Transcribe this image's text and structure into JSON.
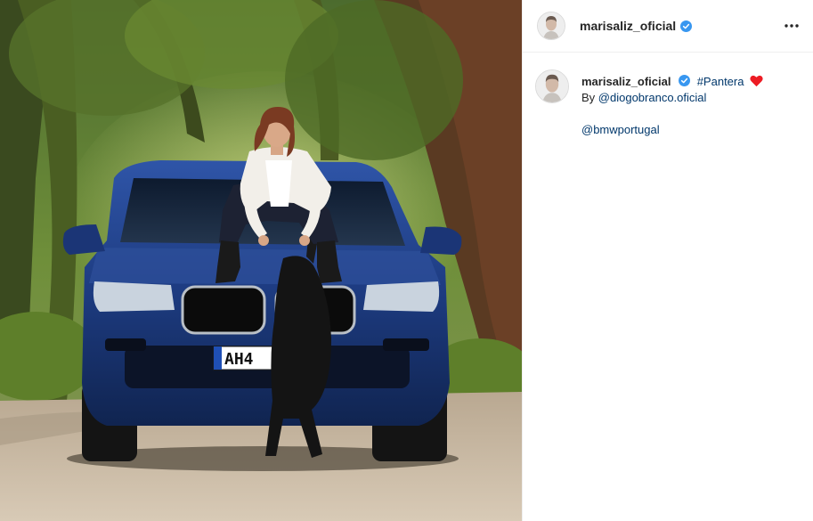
{
  "post": {
    "author": {
      "username": "marisaliz_oficial",
      "verified": true
    },
    "more_options_icon": "more-horizontal-icon",
    "caption": {
      "username": "marisaliz_oficial",
      "hashtag": "#Pantera",
      "emoji": "red-heart",
      "by_prefix": "By",
      "credit_mention": "@diogobranco.oficial",
      "brand_mention": "@bmwportugal"
    },
    "media": {
      "license_plate": "AH4"
    }
  },
  "colors": {
    "verified_blue": "#3897f0",
    "link_blue": "#00376b",
    "heart_red": "#ed1c24",
    "car_blue": "#1e3b7a"
  }
}
